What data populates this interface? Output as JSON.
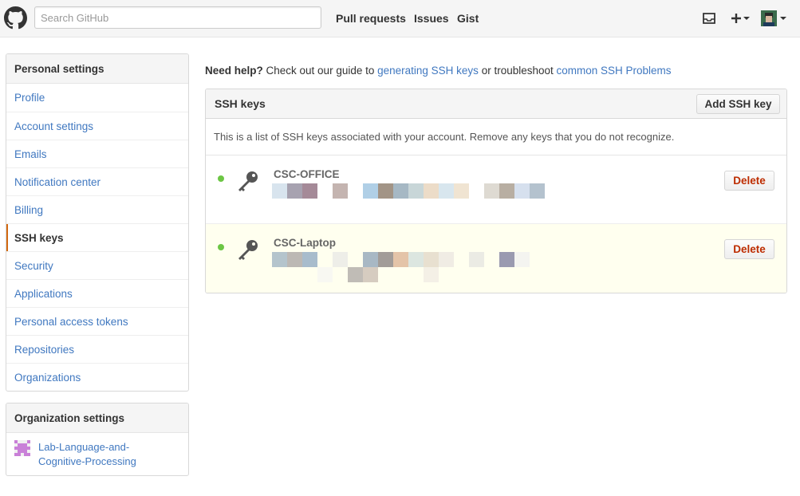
{
  "header": {
    "search_placeholder": "Search GitHub",
    "nav": [
      "Pull requests",
      "Issues",
      "Gist"
    ],
    "icons": [
      "octocat-logo-icon",
      "inbox-icon",
      "plus-icon",
      "avatar"
    ]
  },
  "sidebar": {
    "personal_heading": "Personal settings",
    "items": [
      {
        "label": "Profile"
      },
      {
        "label": "Account settings"
      },
      {
        "label": "Emails"
      },
      {
        "label": "Notification center"
      },
      {
        "label": "Billing"
      },
      {
        "label": "SSH keys",
        "selected": true
      },
      {
        "label": "Security"
      },
      {
        "label": "Applications"
      },
      {
        "label": "Personal access tokens"
      },
      {
        "label": "Repositories"
      },
      {
        "label": "Organizations"
      }
    ],
    "org_heading": "Organization settings",
    "orgs": [
      {
        "line1": "Lab-Language-and-",
        "line2": "Cognitive-Processing"
      }
    ]
  },
  "help": {
    "need_help": "Need help?",
    "text1": " Check out our guide to ",
    "link1": "generating SSH keys",
    "text2": " or troubleshoot ",
    "link2": "common SSH Problems"
  },
  "ssh": {
    "title": "SSH keys",
    "add_button": "Add SSH key",
    "description": "This is a list of SSH keys associated with your account. Remove any keys that you do not recognize.",
    "keys": [
      {
        "title": "CSC-OFFICE",
        "delete_label": "Delete",
        "status_color": "#6cc644"
      },
      {
        "title": "CSC-Laptop",
        "delete_label": "Delete",
        "status_color": "#6cc644"
      }
    ]
  },
  "colors": {
    "link": "#4078c0",
    "selected_accent": "#d26911",
    "delete": "#bd2c00",
    "highlight_row": "#ffffef"
  }
}
